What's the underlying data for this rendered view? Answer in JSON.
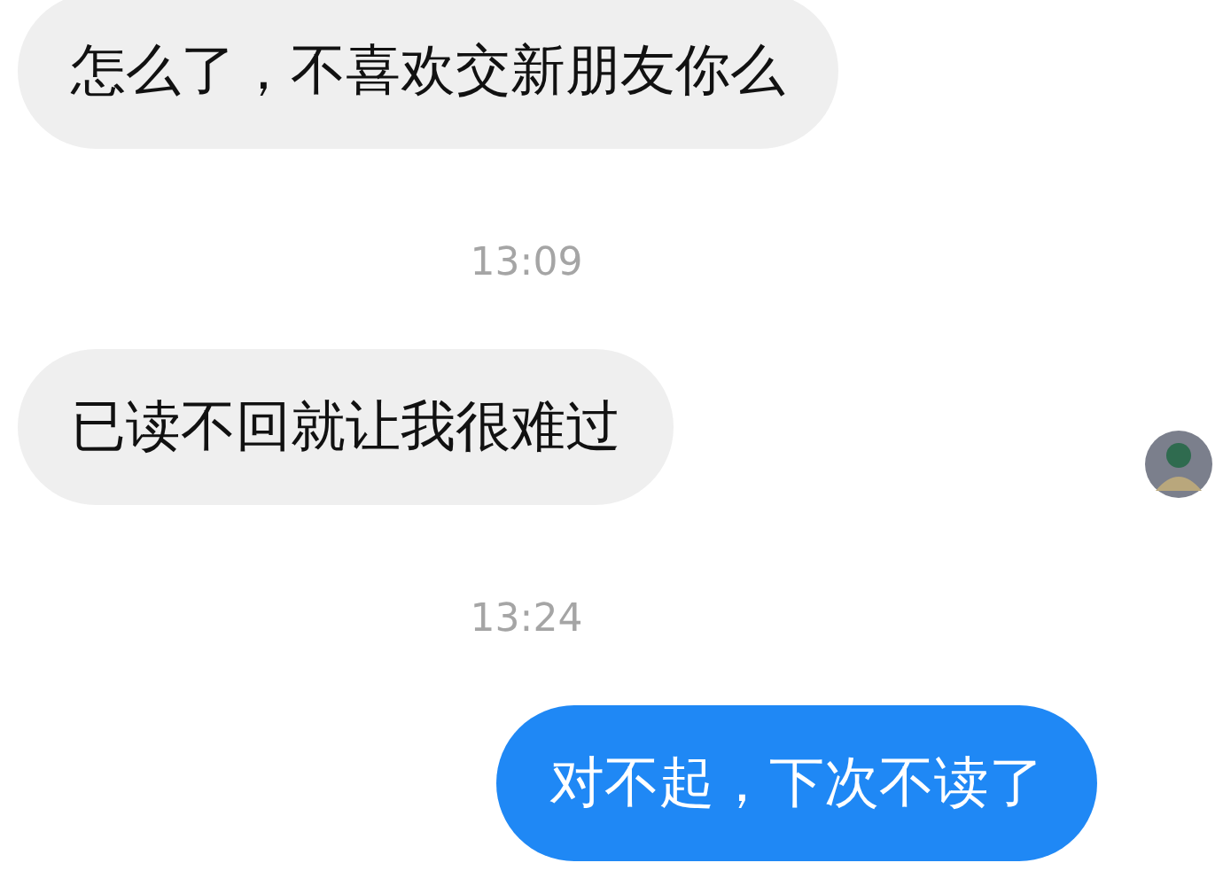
{
  "messages": [
    {
      "kind": "message",
      "outgoing": false,
      "text": "怎么了，不喜欢交新朋友你么",
      "show_avatar": false
    },
    {
      "kind": "time",
      "text": "13:09"
    },
    {
      "kind": "message",
      "outgoing": false,
      "text": "已读不回就让我很难过",
      "show_avatar": true
    },
    {
      "kind": "time",
      "text": "13:24"
    },
    {
      "kind": "message",
      "outgoing": true,
      "text": "对不起，下次不读了",
      "show_avatar": false
    }
  ]
}
